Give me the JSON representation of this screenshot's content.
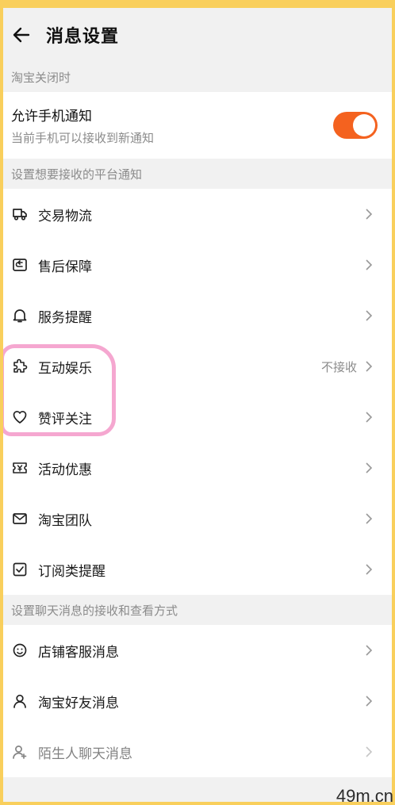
{
  "header": {
    "title": "消息设置",
    "back_icon": "arrow-left-icon"
  },
  "section_closed": {
    "label": "淘宝关闭时",
    "toggle": {
      "main": "允许手机通知",
      "sub": "当前手机可以接收到新通知",
      "enabled": true,
      "color": "#f4621f"
    }
  },
  "section_platform": {
    "label": "设置想要接收的平台通知",
    "items": [
      {
        "label": "交易物流",
        "icon": "truck-icon",
        "value": ""
      },
      {
        "label": "售后保障",
        "icon": "shield-return-icon",
        "value": ""
      },
      {
        "label": "服务提醒",
        "icon": "bell-icon",
        "value": ""
      },
      {
        "label": "互动娱乐",
        "icon": "puzzle-icon",
        "value": "不接收"
      },
      {
        "label": "赞评关注",
        "icon": "heart-icon",
        "value": ""
      },
      {
        "label": "活动优惠",
        "icon": "coupon-icon",
        "value": ""
      },
      {
        "label": "淘宝团队",
        "icon": "mail-icon",
        "value": ""
      },
      {
        "label": "订阅类提醒",
        "icon": "checkbox-icon",
        "value": ""
      }
    ]
  },
  "section_chat": {
    "label": "设置聊天消息的接收和查看方式",
    "items": [
      {
        "label": "店铺客服消息",
        "icon": "smiley-icon",
        "value": ""
      },
      {
        "label": "淘宝好友消息",
        "icon": "person-icon",
        "value": ""
      },
      {
        "label": "陌生人聊天消息",
        "icon": "person-plus-icon",
        "value": ""
      }
    ]
  },
  "watermark": "49m.cn"
}
